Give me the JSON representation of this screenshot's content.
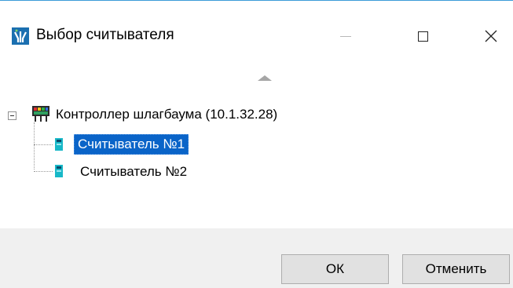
{
  "window": {
    "title": "Выбор считывателя",
    "icon": "app-logo-icon"
  },
  "window_controls": {
    "minimize_icon": "minimize-icon",
    "maximize_icon": "maximize-icon",
    "close_icon": "close-icon"
  },
  "tree": {
    "scroll_up_icon": "scroll-up-arrow-icon",
    "root": {
      "label": "Контроллер шлагбаума (10.1.32.28)",
      "icon": "controller-icon",
      "expanded": true,
      "children": [
        {
          "label": "Считыватель №1",
          "icon": "reader-icon",
          "selected": true
        },
        {
          "label": "Считыватель №2",
          "icon": "reader-icon",
          "selected": false
        }
      ]
    }
  },
  "buttons": {
    "ok_label": "ОК",
    "cancel_label": "Отменить"
  },
  "colors": {
    "selection": "#0a64c8",
    "window_border": "#3c9cd8",
    "footer_bg": "#f0f0f0"
  }
}
